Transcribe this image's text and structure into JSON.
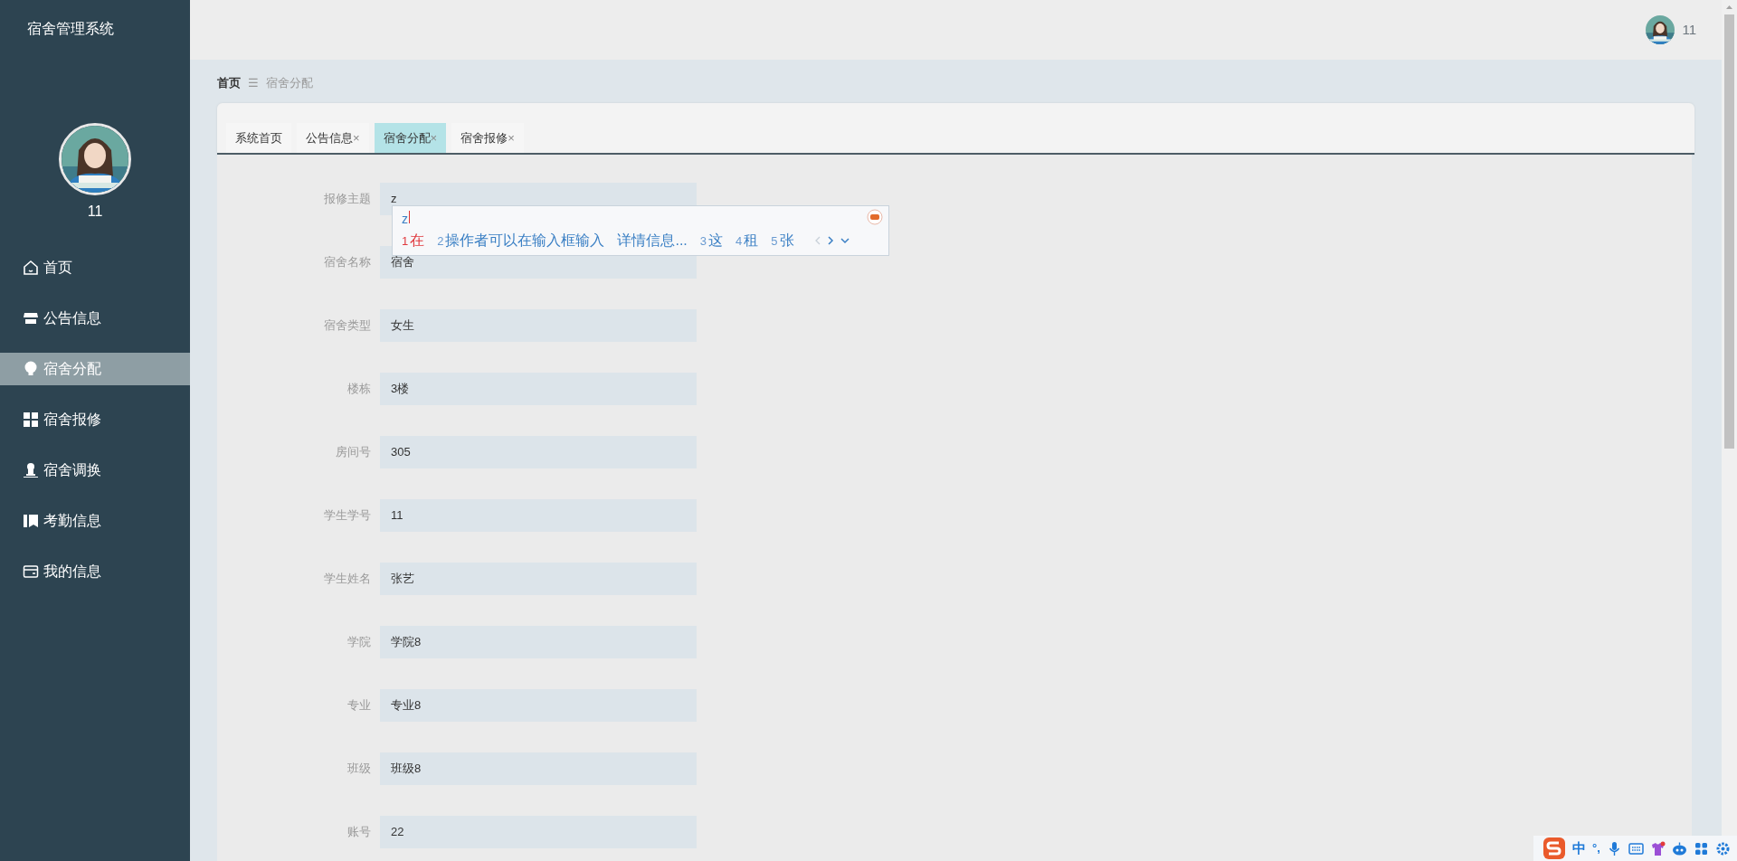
{
  "sidebar": {
    "title": "宿舍管理系统",
    "user": {
      "name": "11"
    },
    "items": [
      {
        "label": "首页",
        "selected": false
      },
      {
        "label": "公告信息",
        "selected": false
      },
      {
        "label": "宿舍分配",
        "selected": true
      },
      {
        "label": "宿舍报修",
        "selected": false
      },
      {
        "label": "宿舍调换",
        "selected": false
      },
      {
        "label": "考勤信息",
        "selected": false
      },
      {
        "label": "我的信息",
        "selected": false
      }
    ]
  },
  "header": {
    "user_name": "11"
  },
  "breadcrumb": {
    "items": [
      "首页",
      "宿舍分配"
    ],
    "separator": "☰"
  },
  "tabs": [
    {
      "label": "系统首页",
      "selected": false
    },
    {
      "label": "公告信息",
      "close": "×",
      "selected": false
    },
    {
      "label": "宿舍分配",
      "close": "×",
      "selected": true
    },
    {
      "label": "宿舍报修",
      "close": "×",
      "selected": false
    }
  ],
  "form": {
    "fields": [
      {
        "label": "报修主题",
        "value": "z"
      },
      {
        "label": "宿舍名称",
        "value": "宿舍"
      },
      {
        "label": "宿舍类型",
        "value": "女生"
      },
      {
        "label": "楼栋",
        "value": "3楼"
      },
      {
        "label": "房间号",
        "value": "305"
      },
      {
        "label": "学生学号",
        "value": "11"
      },
      {
        "label": "学生姓名",
        "value": "张艺"
      },
      {
        "label": "学院",
        "value": "学院8"
      },
      {
        "label": "专业",
        "value": "专业8"
      },
      {
        "label": "班级",
        "value": "班级8"
      },
      {
        "label": "账号",
        "value": "22"
      }
    ]
  },
  "ime": {
    "composition": "z",
    "candidates": [
      {
        "kind": "candidate",
        "index": "1",
        "text": "在",
        "selected": true
      },
      {
        "kind": "candidate",
        "index": "2",
        "text": "操作者可以在输入框输入",
        "selected": false
      },
      {
        "kind": "link",
        "text": "详情信息..."
      },
      {
        "kind": "candidate",
        "index": "3",
        "text": "这",
        "selected": false
      },
      {
        "kind": "candidate",
        "index": "4",
        "text": "租",
        "selected": false
      },
      {
        "kind": "candidate",
        "index": "5",
        "text": "张",
        "selected": false
      }
    ]
  },
  "ime_toolbar": {
    "language": "中",
    "punctuation": "°,"
  }
}
